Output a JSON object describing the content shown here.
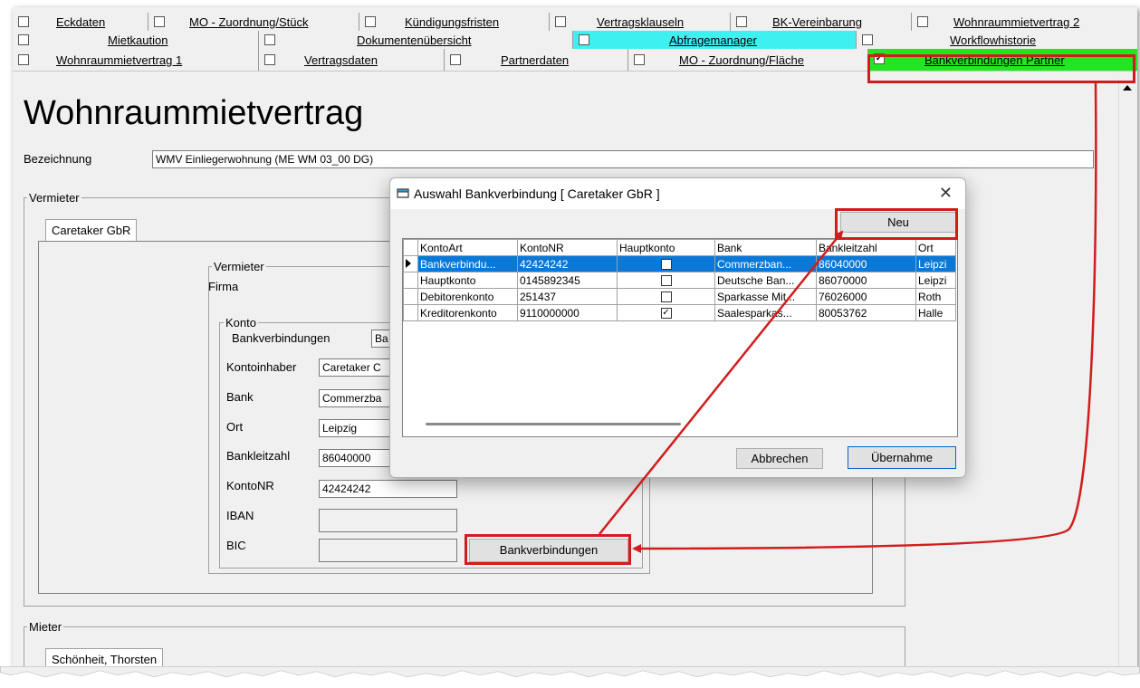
{
  "tabs": {
    "row1": [
      "Eckdaten",
      "MO - Zuordnung/Stück",
      "Kündigungsfristen",
      "Vertragsklauseln",
      "BK-Vereinbarung",
      "Wohnraummietvertrag 2"
    ],
    "row2": [
      "Mietkaution",
      "Dokumentenübersicht",
      "Abfragemanager",
      "Workflowhistorie"
    ],
    "row3": [
      "Wohnraummietvertrag 1",
      "Vertragsdaten",
      "Partnerdaten",
      "MO - Zuordnung/Fläche",
      "Bankverbindungen Partner"
    ]
  },
  "main": {
    "title": "Wohnraummietvertrag",
    "bezeichnung_label": "Bezeichnung",
    "bezeichnung_value": "WMV Einliegerwohnung (ME WM 03_00 DG)",
    "vermieter_group": "Vermieter",
    "vermieter_tab": "Caretaker GbR",
    "vermieter_inner_group": "Vermieter",
    "firma_label": "Firma",
    "konto_group": "Konto",
    "bankverbindungen_label": "Bankverbindungen",
    "bankverbindungen_value": "Ba",
    "kontoinhaber_label": "Kontoinhaber",
    "kontoinhaber_value": "Caretaker C",
    "bank_label": "Bank",
    "bank_value": "Commerzba",
    "ort_label": "Ort",
    "ort_value": "Leipzig",
    "bankleitzahl_label": "Bankleitzahl",
    "bankleitzahl_value": "86040000",
    "kontonr_label": "KontoNR",
    "kontonr_value": "42424242",
    "iban_label": "IBAN",
    "bic_label": "BIC",
    "bankverbindungen_button": "Bankverbindungen",
    "mieter_group": "Mieter",
    "mieter_tab": "Schönheit, Thorsten"
  },
  "dialog": {
    "title": "Auswahl Bankverbindung [ Caretaker GbR ]",
    "close": "✕",
    "neu_button": "Neu",
    "columns": [
      "KontoArt",
      "KontoNR",
      "Hauptkonto",
      "Bank",
      "Bankleitzahl",
      "Ort"
    ],
    "rows": [
      {
        "kontoart": "Bankverbindu...",
        "kontonr": "42424242",
        "hauptkonto": "",
        "bank": "Commerzban...",
        "blz": "86040000",
        "ort": "Leipzi"
      },
      {
        "kontoart": "Hauptkonto",
        "kontonr": "0145892345",
        "hauptkonto": "",
        "bank": "Deutsche Ban...",
        "blz": "86070000",
        "ort": "Leipzi"
      },
      {
        "kontoart": "Debitorenkonto",
        "kontonr": "251437",
        "hauptkonto": "",
        "bank": "Sparkasse Mit...",
        "blz": "76026000",
        "ort": "Roth"
      },
      {
        "kontoart": "Kreditorenkonto",
        "kontonr": "9110000000",
        "hauptkonto": "✓",
        "bank": "Saalesparkas...",
        "blz": "80053762",
        "ort": "Halle"
      }
    ],
    "abbrechen_button": "Abbrechen",
    "uebernahme_button": "Übernahme"
  },
  "colors": {
    "highlight_cyan": "#3ff0f0",
    "highlight_green": "#22e622",
    "annotation_red": "#d21c1c",
    "selection_blue": "#0a78d7"
  }
}
